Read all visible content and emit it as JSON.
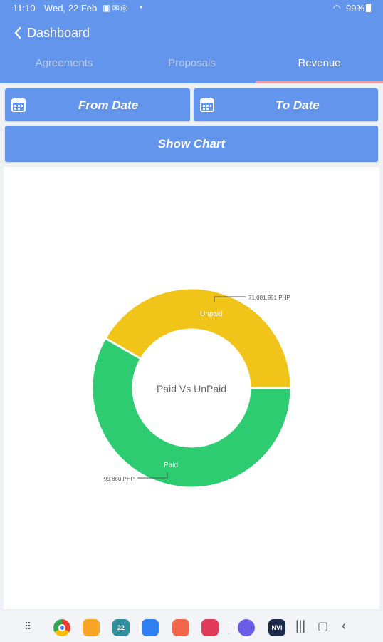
{
  "status_bar": {
    "time": "11:10",
    "date": "Wed, 22 Feb",
    "notification_icons": [
      "gallery-icon",
      "mail-icon",
      "sync-icon"
    ],
    "battery": "99%"
  },
  "header": {
    "title": "Dashboard",
    "background_color": "#6495ed"
  },
  "tabs": [
    {
      "label": "Agreements",
      "selected": false
    },
    {
      "label": "Proposals",
      "selected": false
    },
    {
      "label": "Revenue",
      "selected": true
    }
  ],
  "filters": {
    "from_date_label": "From Date",
    "to_date_label": "To Date",
    "show_chart_label": "Show Chart"
  },
  "chart_data": {
    "type": "pie",
    "center_label": "Paid Vs UnPaid",
    "slices": [
      {
        "label": "Unpaid",
        "value_text": "71,081,961 PHP",
        "value": 71081961,
        "color": "#f0c419"
      },
      {
        "label": "Paid",
        "value_text": "99,880 PHP",
        "value": 99880,
        "color": "#2ecc71"
      }
    ]
  },
  "nav_bar": {
    "apps": [
      {
        "name": "chrome-app-icon",
        "color": "#ffffff"
      },
      {
        "name": "files-app-icon",
        "color": "#f6a623"
      },
      {
        "name": "calendar-app-icon",
        "color": "#2f8f9d",
        "text": "22"
      },
      {
        "name": "messages-app-icon",
        "color": "#2f7ff5"
      },
      {
        "name": "contacts-app-icon",
        "color": "#f2664b"
      },
      {
        "name": "gallery-app-icon",
        "color": "#e23a5a"
      },
      {
        "name": "internet-app-icon",
        "color": "#6a5ee6"
      },
      {
        "name": "news-app-icon",
        "color": "#1b2a4a",
        "text": "NVI"
      }
    ]
  }
}
